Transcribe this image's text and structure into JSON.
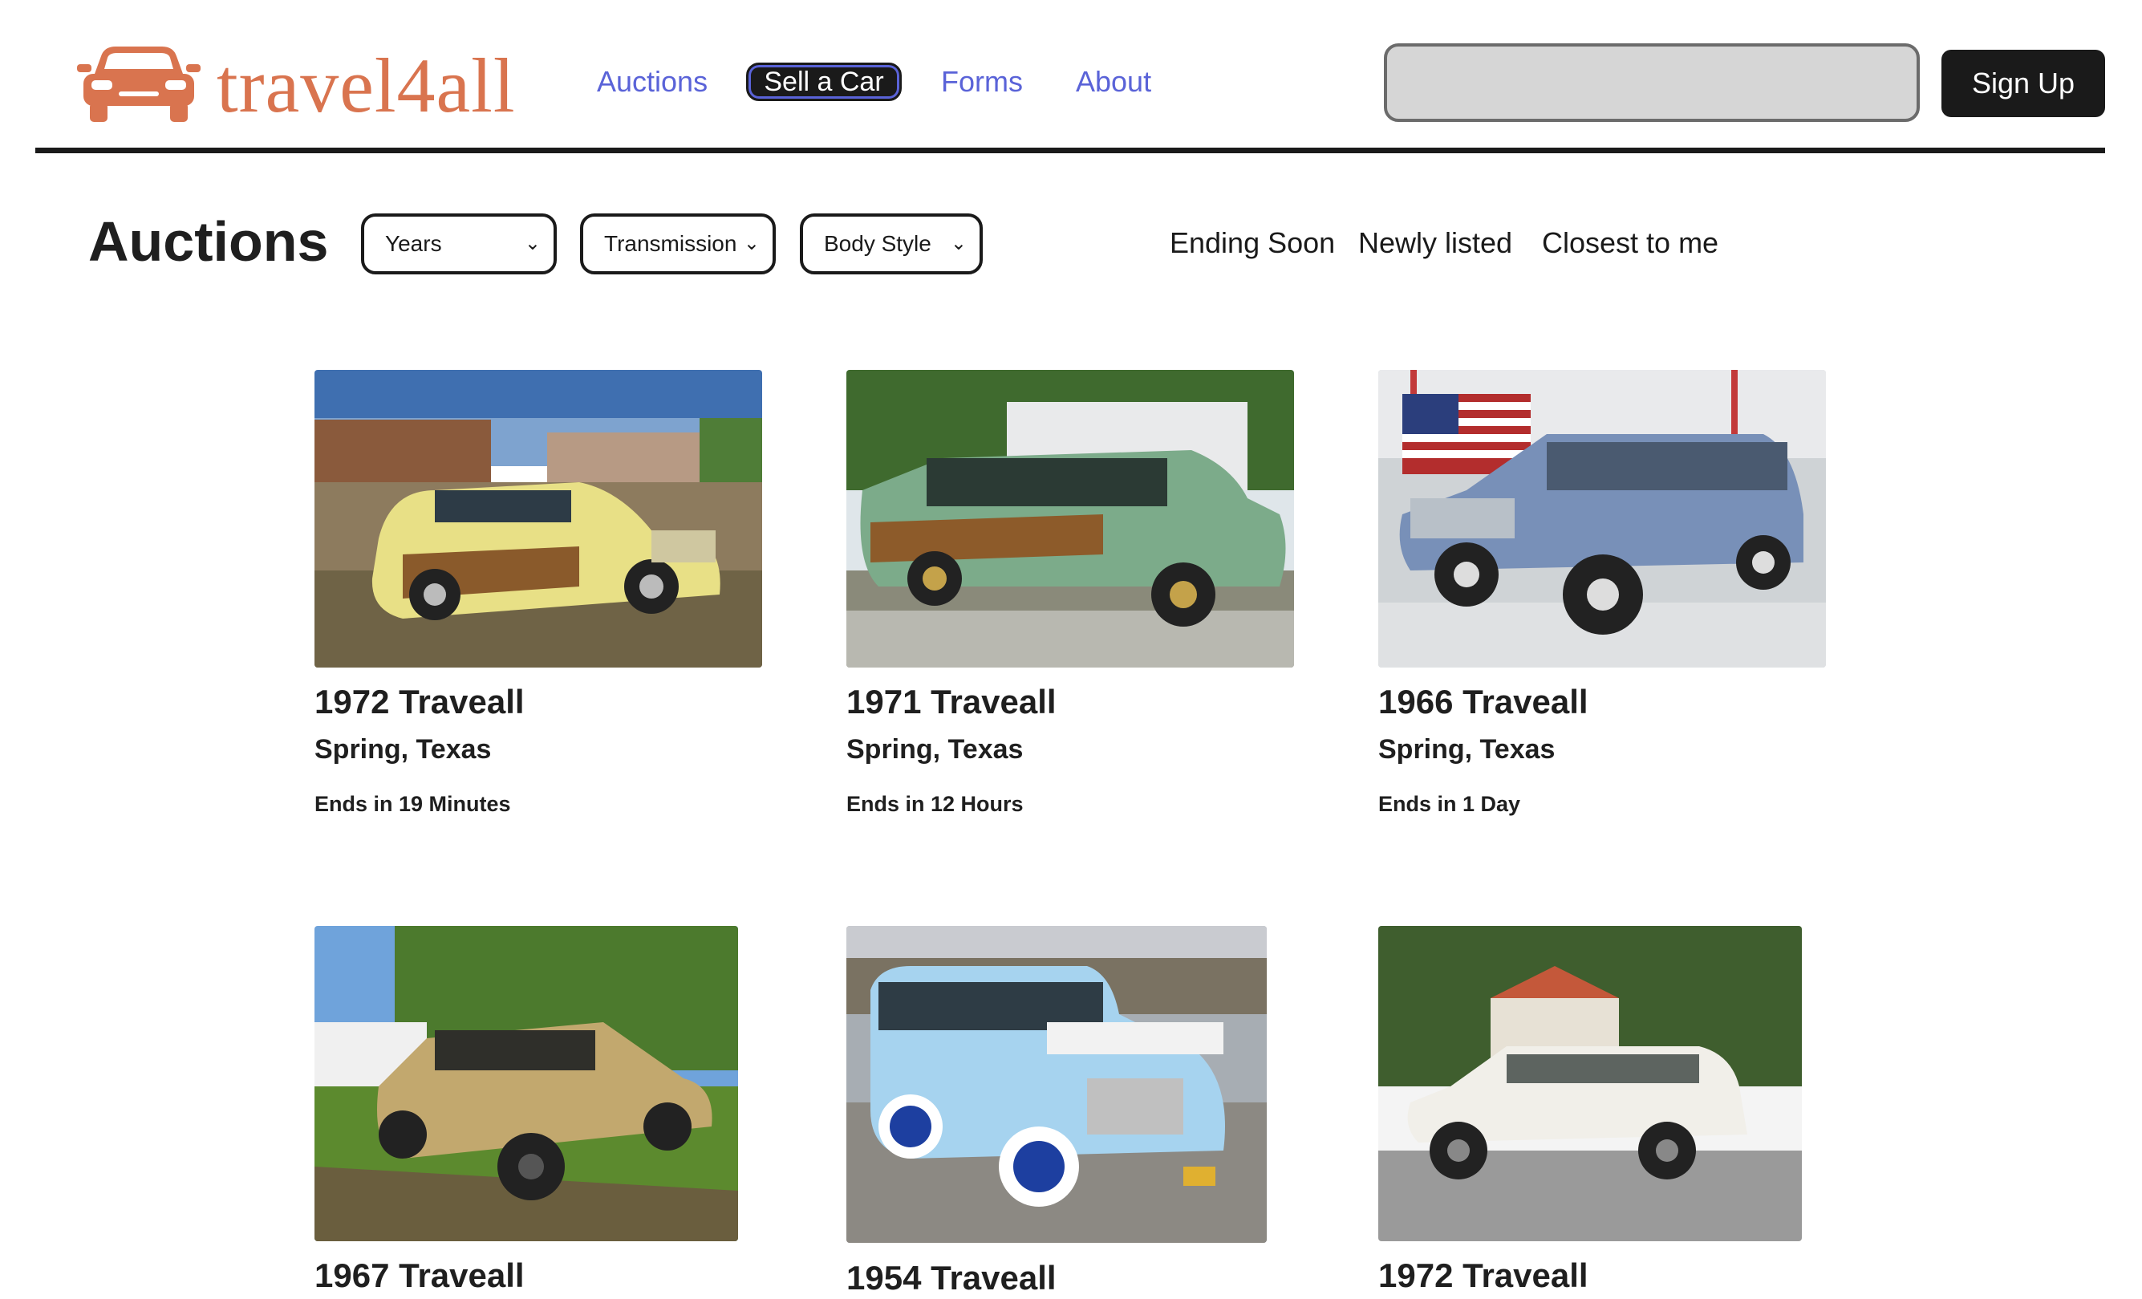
{
  "header": {
    "logo_text": "travel4all",
    "logo_icon": "car-icon",
    "nav": [
      {
        "label": "Auctions"
      },
      {
        "label": "Sell a Car"
      },
      {
        "label": "Forms"
      },
      {
        "label": "About"
      }
    ],
    "search": {
      "placeholder": "",
      "value": ""
    },
    "signup_label": "Sign Up"
  },
  "main": {
    "title": "Auctions",
    "filters": [
      {
        "label": "Years"
      },
      {
        "label": "Transmission"
      },
      {
        "label": "Body Style"
      }
    ],
    "sorts": [
      {
        "label": "Ending Soon"
      },
      {
        "label": "Newly listed"
      },
      {
        "label": "Closest to me"
      }
    ],
    "listings": [
      {
        "title": "1972 Traveall",
        "location": "Spring, Texas",
        "ends": "Ends in 19 Minutes",
        "image": "yellow-woodgrain-wagon-photo"
      },
      {
        "title": "1971 Traveall",
        "location": "Spring, Texas",
        "ends": "Ends in 12 Hours",
        "image": "green-woodgrain-wagon-photo"
      },
      {
        "title": "1966 Traveall",
        "location": "Spring, Texas",
        "ends": "Ends in 1 Day",
        "image": "blue-wagon-showroom-photo"
      },
      {
        "title": "1967 Traveall",
        "location": "",
        "ends": "",
        "image": "gold-wagon-photo"
      },
      {
        "title": "1954 Traveall",
        "location": "",
        "ends": "",
        "image": "light-blue-vintage-wagon-photo"
      },
      {
        "title": "1972 Traveall",
        "location": "",
        "ends": "",
        "image": "white-wagon-photo"
      }
    ]
  },
  "colors": {
    "brand": "#d9744f",
    "nav_link": "#5a63d8",
    "dark": "#1a1a1a",
    "search_bg": "#d6d6d6"
  }
}
